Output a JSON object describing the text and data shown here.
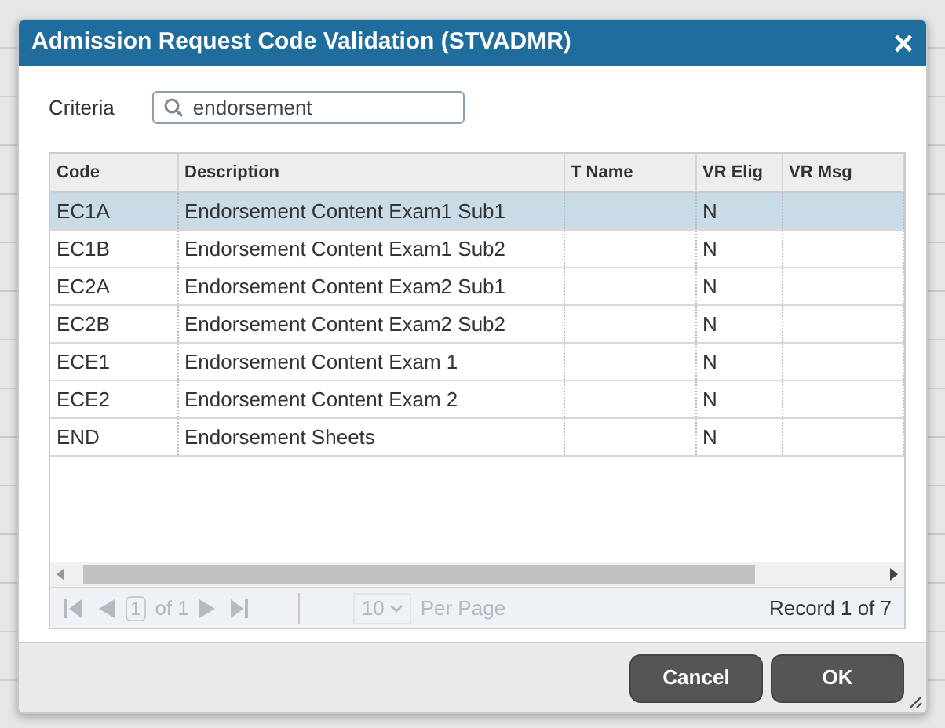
{
  "dialog": {
    "title": "Admission Request Code Validation (STVADMR)",
    "close": "×"
  },
  "criteria": {
    "label": "Criteria",
    "value": "endorsement"
  },
  "table": {
    "columns": [
      "Code",
      "Description",
      "T Name",
      "VR Elig",
      "VR Msg"
    ],
    "rows": [
      {
        "cells": [
          "EC1A",
          "Endorsement Content Exam1 Sub1",
          "",
          "N",
          ""
        ],
        "selected": true
      },
      {
        "cells": [
          "EC1B",
          "Endorsement Content Exam1 Sub2",
          "",
          "N",
          ""
        ],
        "selected": false
      },
      {
        "cells": [
          "EC2A",
          "Endorsement Content Exam2 Sub1",
          "",
          "N",
          ""
        ],
        "selected": false
      },
      {
        "cells": [
          "EC2B",
          "Endorsement Content Exam2 Sub2",
          "",
          "N",
          ""
        ],
        "selected": false
      },
      {
        "cells": [
          "ECE1",
          "Endorsement Content Exam 1",
          "",
          "N",
          ""
        ],
        "selected": false
      },
      {
        "cells": [
          "ECE2",
          "Endorsement Content Exam 2",
          "",
          "N",
          ""
        ],
        "selected": false
      },
      {
        "cells": [
          "END",
          "Endorsement Sheets",
          "",
          "N",
          ""
        ],
        "selected": false
      }
    ]
  },
  "pager": {
    "nav_disabled": true,
    "page": "1",
    "of": "of 1",
    "per_page": "10",
    "per_page_label": "Per Page",
    "record": "Record 1 of 7"
  },
  "buttons": [
    {
      "label": "Cancel"
    },
    {
      "label": "OK"
    }
  ]
}
